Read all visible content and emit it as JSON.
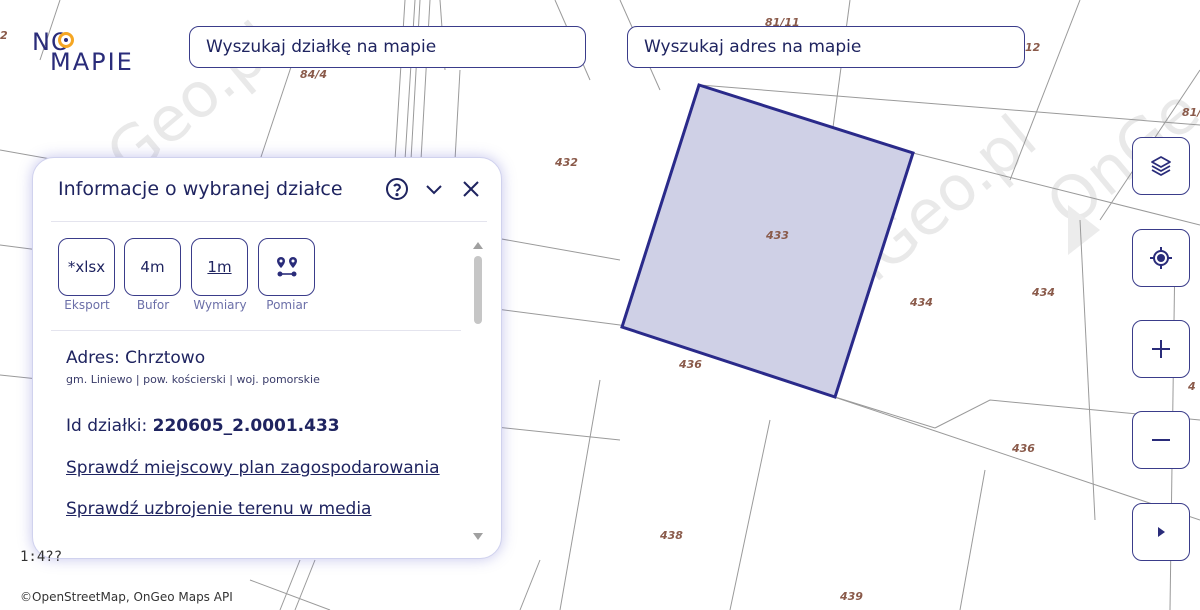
{
  "header": {
    "logo_line1": "NO",
    "logo_line2": "MAPIE",
    "search_plot_placeholder": "Wyszukaj działkę na mapie",
    "search_address_placeholder": "Wyszukaj adres na mapie"
  },
  "map": {
    "watermark": "OnGeo.pl",
    "selected_plot_fill": "#cfd0e6",
    "selected_plot_stroke": "#2a2a8a",
    "plot_labels": [
      "81/11",
      "84/4",
      "12",
      "81/",
      "432",
      "433",
      "434",
      "434",
      "436",
      "436",
      "438",
      "439",
      "2",
      "4"
    ]
  },
  "panel": {
    "title": "Informacje o wybranej działce",
    "tools": [
      {
        "label": "Eksport",
        "value": "*xlsx"
      },
      {
        "label": "Bufor",
        "value": "4m"
      },
      {
        "label": "Wymiary",
        "value": "1m"
      },
      {
        "label": "Pomiar",
        "value": ""
      }
    ],
    "address_title": "Adres: Chrztowo",
    "address_sub": "gm. Liniewo | pow. kościerski | woj. pomorskie",
    "id_label": "Id działki:",
    "id_value": "220605_2.0001.433",
    "link_plan": "Sprawdź miejscowy plan zagospodarowania",
    "link_media": "Sprawdź uzbrojenie terenu w media"
  },
  "footer": {
    "scale": "1:4??",
    "attribution": "©OpenStreetMap, OnGeo Maps API"
  },
  "colors": {
    "accent": "#2a2c7a",
    "logo_pin": "#f5a623"
  }
}
